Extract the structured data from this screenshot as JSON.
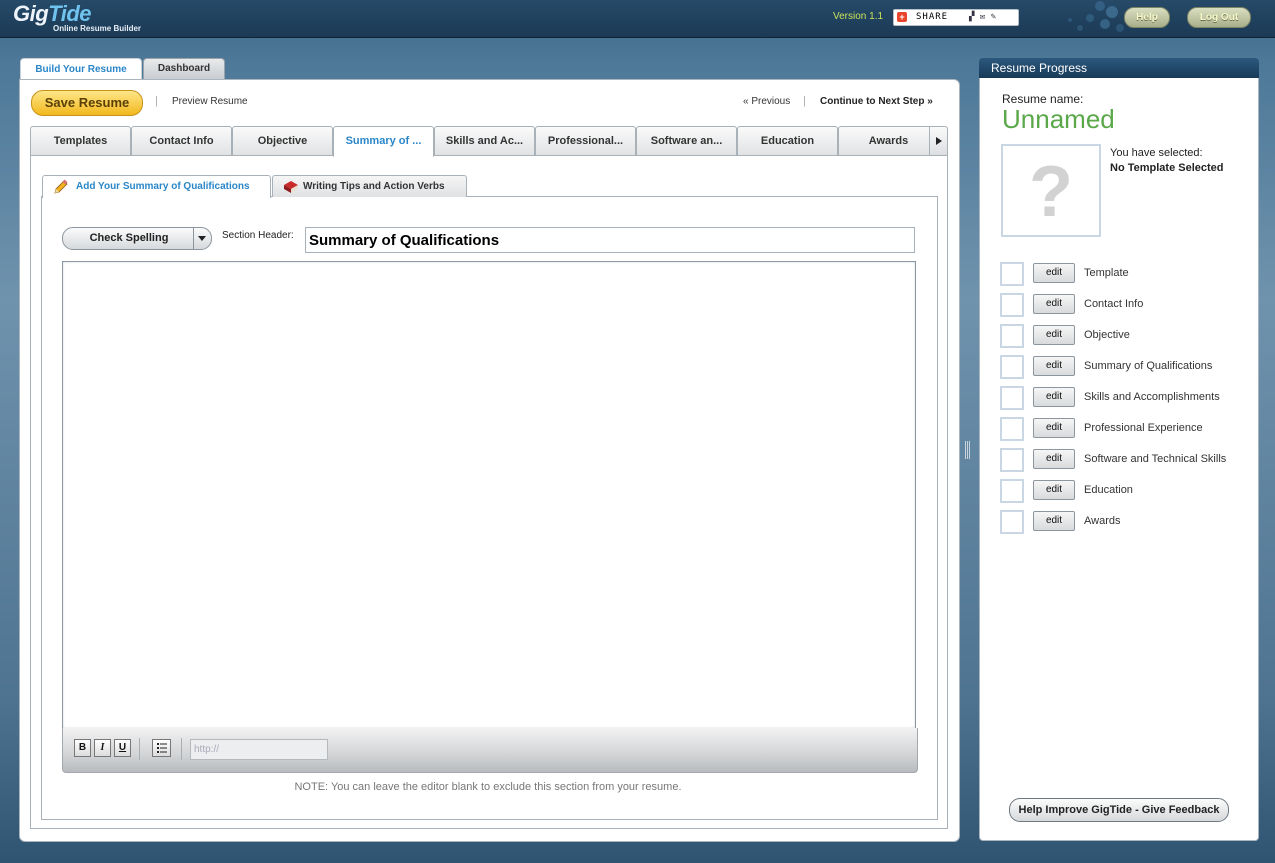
{
  "app": {
    "logo_text": "GigTide",
    "logo_subtitle": "Online Resume Builder",
    "version": "Version 1.1",
    "share_label": "SHARE",
    "help_label": "Help",
    "logout_label": "Log Out"
  },
  "top_tabs": [
    {
      "label": "Build Your Resume",
      "active": true
    },
    {
      "label": "Dashboard",
      "active": false
    }
  ],
  "actions": {
    "save_label": "Save Resume",
    "preview_label": "Preview Resume",
    "previous_label": "« Previous",
    "next_label": "Continue to Next Step »"
  },
  "steps": [
    {
      "label": "Templates"
    },
    {
      "label": "Contact Info"
    },
    {
      "label": "Objective"
    },
    {
      "label": "Summary of ...",
      "active": true
    },
    {
      "label": "Skills and Ac..."
    },
    {
      "label": "Professional..."
    },
    {
      "label": "Software an..."
    },
    {
      "label": "Education"
    },
    {
      "label": "Awards"
    }
  ],
  "sub_tabs": [
    {
      "label": "Add Your Summary of Qualifications",
      "active": true
    },
    {
      "label": "Writing Tips and Action Verbs",
      "active": false
    }
  ],
  "editor": {
    "spell_label": "Check Spelling",
    "section_header_label": "Section Header:",
    "section_header_value": "Summary of Qualifications",
    "bold": "B",
    "italic": "I",
    "underline": "U",
    "url_placeholder": "http://",
    "note": "NOTE: You can leave the editor blank to exclude this section from your resume."
  },
  "progress": {
    "title": "Resume Progress",
    "resume_name_label": "Resume name:",
    "resume_name_value": "Unnamed",
    "selected_label": "You have selected:",
    "selected_value": "No Template Selected",
    "edit_label": "edit",
    "items": [
      {
        "label": "Template"
      },
      {
        "label": "Contact Info"
      },
      {
        "label": "Objective"
      },
      {
        "label": "Summary of Qualifications"
      },
      {
        "label": "Skills and Accomplishments"
      },
      {
        "label": "Professional Experience"
      },
      {
        "label": "Software and Technical Skills"
      },
      {
        "label": "Education"
      },
      {
        "label": "Awards"
      }
    ],
    "feedback_label": "Help Improve GigTide - Give Feedback"
  }
}
